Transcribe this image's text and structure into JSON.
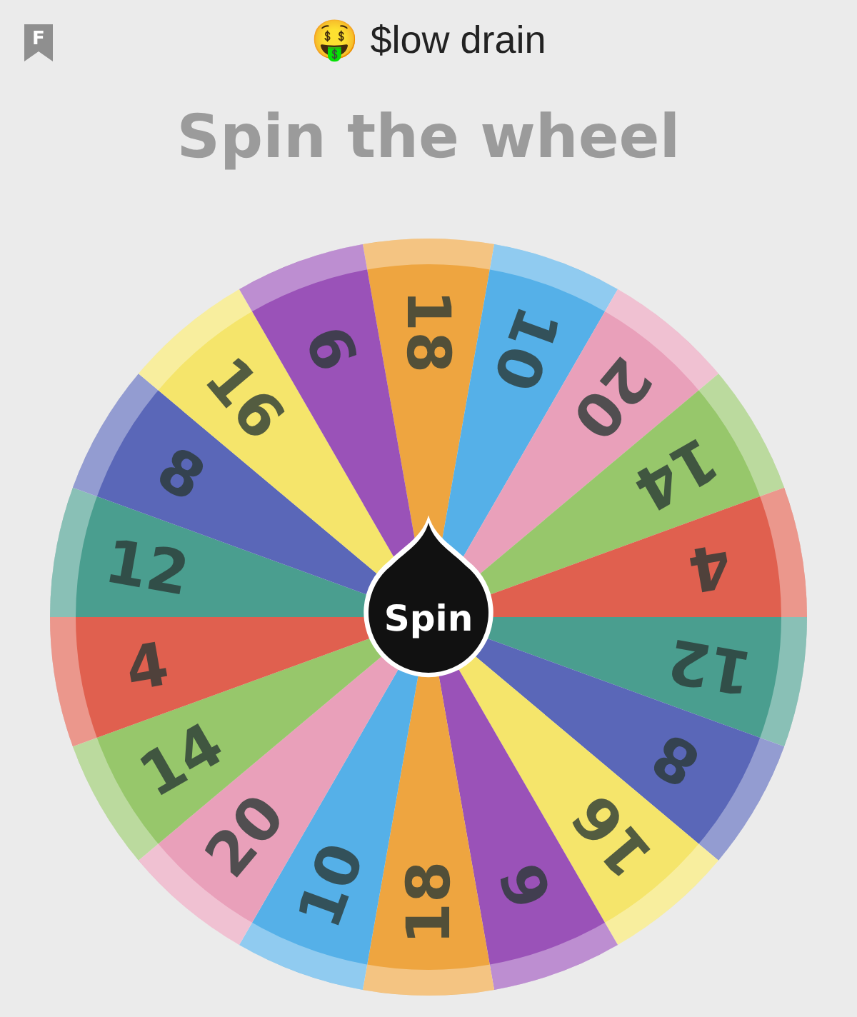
{
  "header": {
    "badge": "F",
    "title": "🤑 $low drain"
  },
  "heading": "Spin the wheel",
  "wheel": {
    "segments": [
      {
        "label": "18",
        "color": "#eea540"
      },
      {
        "label": "10",
        "color": "#55b0e8"
      },
      {
        "label": "20",
        "color": "#e9a0ba"
      },
      {
        "label": "14",
        "color": "#97c76b"
      },
      {
        "label": "4",
        "color": "#e0604f"
      },
      {
        "label": "12",
        "color": "#4a9e8f"
      },
      {
        "label": "8",
        "color": "#5a67b8"
      },
      {
        "label": "16",
        "color": "#f5e56b"
      },
      {
        "label": "6",
        "color": "#9a52b8"
      },
      {
        "label": "18",
        "color": "#eea540"
      },
      {
        "label": "10",
        "color": "#55b0e8"
      },
      {
        "label": "20",
        "color": "#e9a0ba"
      },
      {
        "label": "14",
        "color": "#97c76b"
      },
      {
        "label": "4",
        "color": "#e0604f"
      },
      {
        "label": "12",
        "color": "#4a9e8f"
      },
      {
        "label": "8",
        "color": "#5a67b8"
      },
      {
        "label": "16",
        "color": "#f5e56b"
      },
      {
        "label": "6",
        "color": "#9a52b8"
      }
    ],
    "button": "Spin"
  }
}
